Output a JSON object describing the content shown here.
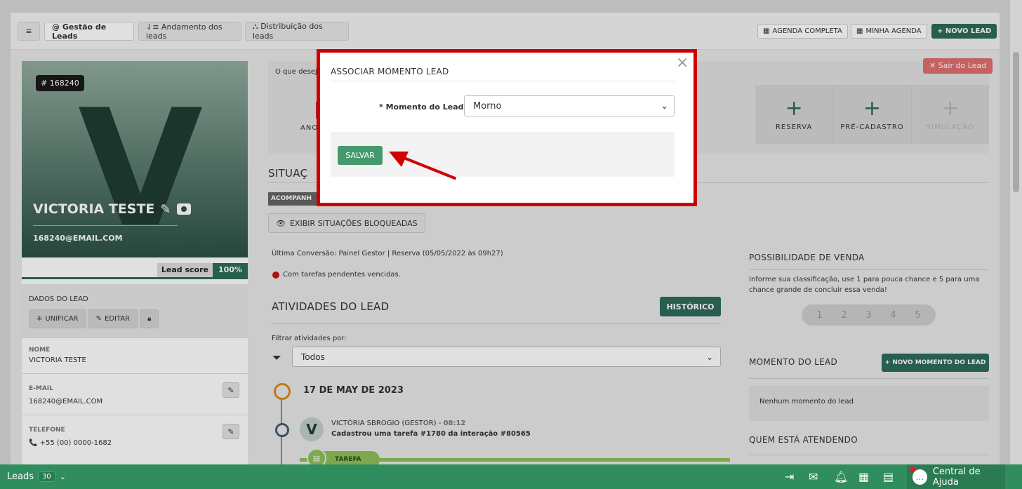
{
  "topbar": {
    "menu_icon": "≡",
    "tabs": [
      {
        "label": "@ Gestão de Leads",
        "active": true
      },
      {
        "label": "⇃≡ Andamento dos leads",
        "active": false
      },
      {
        "label": "⛬ Distribuição dos leads",
        "active": false
      }
    ],
    "agenda_completa": "AGENDA COMPLETA",
    "minha_agenda": "MINHA AGENDA",
    "novo_lead": "+ NOVO LEAD"
  },
  "lead": {
    "id_badge": "# 168240",
    "initial": "V",
    "name": "VICTORIA TESTE",
    "email": "168240@EMAIL.COM",
    "score_label": "Lead score",
    "score_value": "100%",
    "score_fraction": 1.0,
    "dados_title": "DADOS DO LEAD",
    "btn_unificar": "UNIFICAR",
    "btn_editar": "EDITAR",
    "fields": [
      {
        "label": "NOME",
        "value": "VICTORIA TESTE"
      },
      {
        "label": "E-MAIL",
        "value": "168240@EMAIL.COM"
      },
      {
        "label": "TELEFONE",
        "value": "📞 +55 (00) 0000-1682"
      }
    ]
  },
  "main": {
    "question_prefix": "O que desej",
    "anot_partial": "ANO",
    "sair": "✕ Sair do Lead",
    "actions": [
      {
        "label": "RESERVA",
        "disabled": false
      },
      {
        "label": "PRÉ-CADASTRO",
        "disabled": false
      },
      {
        "label": "SIMULAÇÃO",
        "disabled": true
      }
    ],
    "situacao_partial": "SITUAÇ",
    "acomp_partial": "ACOMPANH",
    "exibir": "EXIBIR SITUAÇÕES BLOQUEADAS",
    "ultima_conversao": "Última Conversão: Painel Gestor | Reserva (05/05/2022 às 09h27)",
    "pendentes": "Com tarefas pendentes vencidas.",
    "atividades_title": "ATIVIDADES DO LEAD",
    "historico": "HISTÓRICO",
    "filtrar_label": "Filtrar atividades por:",
    "filtro_value": "Todos",
    "date_label": "17 DE MAY DE 2023",
    "activity_author": "VICTÓRIA SBROGIO (GESTOR) - ",
    "activity_time": "08:12",
    "activity_desc": "Cadastrou uma tarefa #1780 da interação #80565",
    "tarefa_label": "TAREFA"
  },
  "right": {
    "possibilidade_title": "POSSIBILIDADE DE VENDA",
    "possibilidade_desc": "Informe sua classificação, use 1 para pouca chance e 5 para uma chance grande de concluir essa venda!",
    "ratings": [
      "1",
      "2",
      "3",
      "4",
      "5"
    ],
    "momento_title": "MOMENTO DO LEAD",
    "novo_momento": "+ NOVO MOMENTO DO LEAD",
    "nenhum_momento": "Nenhum momento do lead",
    "quem_title": "QUEM ESTÁ ATENDENDO"
  },
  "modal": {
    "title": "ASSOCIAR MOMENTO LEAD",
    "close": "×",
    "field_label": "* Momento do Lead",
    "field_value": "Morno",
    "save": "SALVAR",
    "frame_color": "#cc0000"
  },
  "bottombar": {
    "leads_label": "Leads",
    "leads_count": "30",
    "help_label": "Central de Ajuda"
  }
}
